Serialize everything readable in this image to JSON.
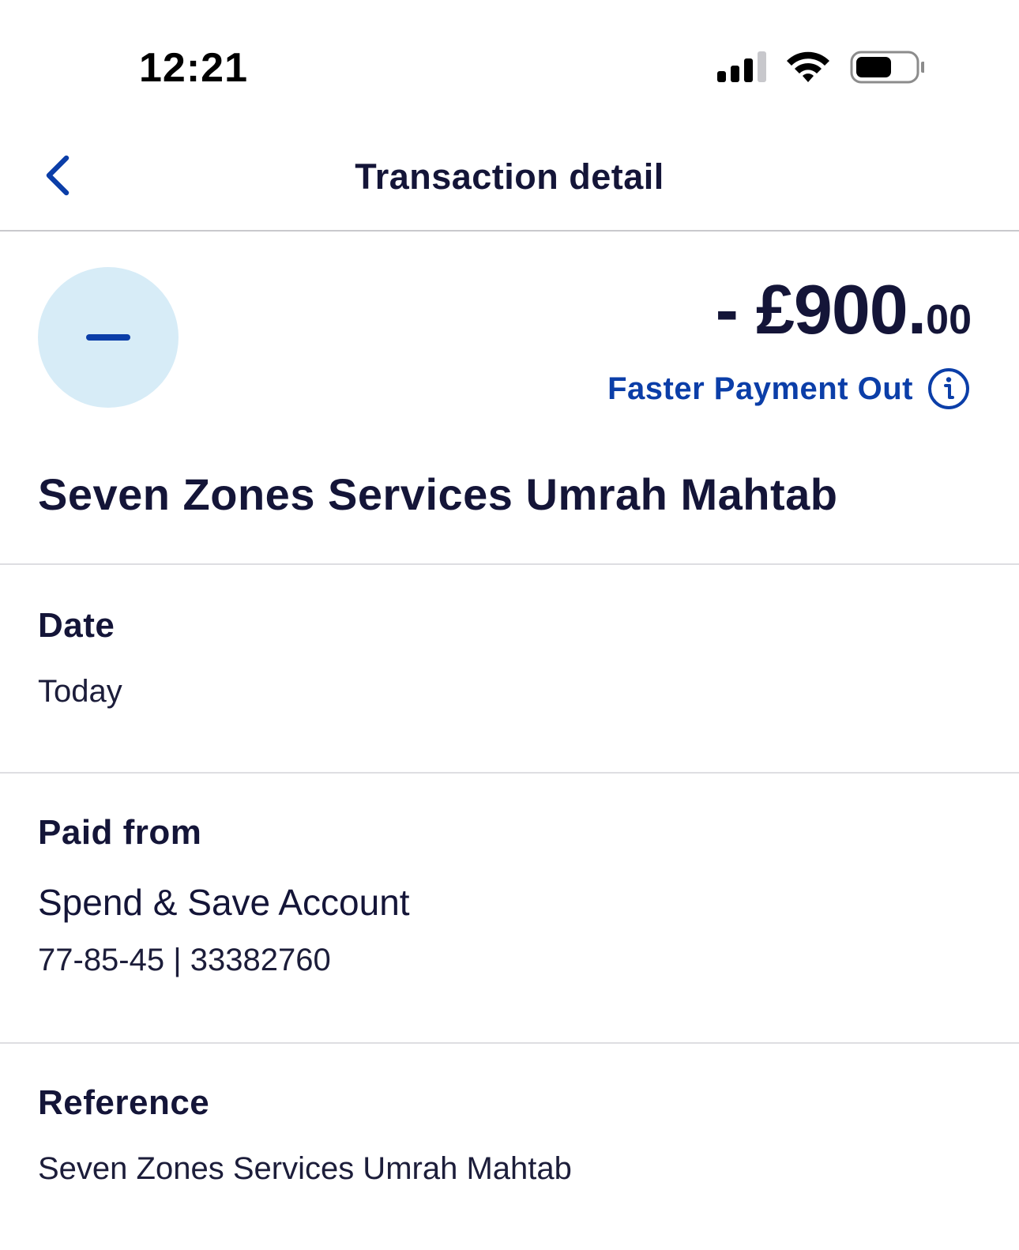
{
  "status_bar": {
    "time": "12:21",
    "icons": [
      "cellular-signal-icon",
      "wifi-icon",
      "battery-icon"
    ]
  },
  "header": {
    "title": "Transaction detail",
    "back_icon": "chevron-left-icon"
  },
  "transaction": {
    "direction_icon": "minus-icon",
    "amount_sign": "-",
    "amount_main": "£900.",
    "amount_pence": "00",
    "payment_type": "Faster Payment Out",
    "payment_type_icon": "info-icon",
    "payee": "Seven Zones Services Umrah Mahtab"
  },
  "details": {
    "date": {
      "label": "Date",
      "value": "Today"
    },
    "paid_from": {
      "label": "Paid from",
      "account_name": "Spend & Save Account",
      "account_numbers": "77-85-45 | 33382760"
    },
    "reference": {
      "label": "Reference",
      "value": "Seven Zones Services Umrah Mahtab"
    }
  },
  "colors": {
    "accent": "#0b3ea8",
    "text_primary": "#141538",
    "icon_bg": "#d7ecf7",
    "divider": "#dedee2"
  }
}
